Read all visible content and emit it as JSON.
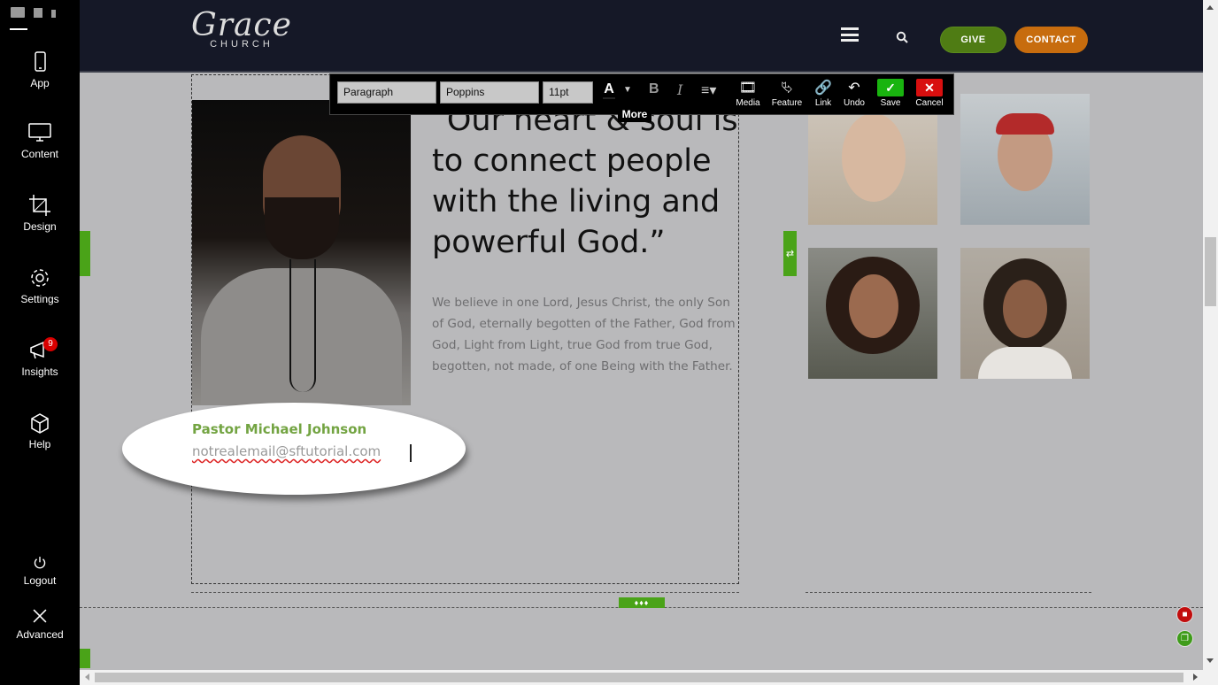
{
  "sidebar": {
    "items": [
      {
        "label": "App",
        "icon": "phone-icon"
      },
      {
        "label": "Content",
        "icon": "monitor-icon"
      },
      {
        "label": "Design",
        "icon": "crop-icon"
      },
      {
        "label": "Settings",
        "icon": "gear-icon"
      },
      {
        "label": "Insights",
        "icon": "megaphone-icon",
        "badge": "9"
      },
      {
        "label": "Help",
        "icon": "box-icon"
      },
      {
        "label": "Logout",
        "icon": "power-icon"
      },
      {
        "label": "Advanced",
        "icon": "tools-icon"
      }
    ]
  },
  "header": {
    "logo_script": "Grace",
    "logo_sub": "CHURCH",
    "give_label": "GIVE",
    "contact_label": "CONTACT"
  },
  "toolbar": {
    "block_format": "Paragraph",
    "font": "Poppins",
    "size": "11pt",
    "media_label": "Media",
    "feature_label": "Feature",
    "link_label": "Link",
    "undo_label": "Undo",
    "save_label": "Save",
    "cancel_label": "Cancel",
    "more_label": "More"
  },
  "content": {
    "quote": "“Our heart & soul is to connect people with the living and powerful God.”",
    "body": "We believe in one Lord, Jesus Christ, the only Son of God, eternally begotten of the Father, God from God, Light from Light, true God from true God, begotten, not made, of one Being with the Father.",
    "pastor_name": "Pastor Michael Johnson",
    "pastor_email": "notrealemail@sftutorial.com"
  },
  "colors": {
    "accent_green": "#4aa318",
    "give_green": "#4f7c14",
    "contact_orange": "#c76c0e",
    "name_green": "#73a442",
    "header_bg": "#151827"
  }
}
